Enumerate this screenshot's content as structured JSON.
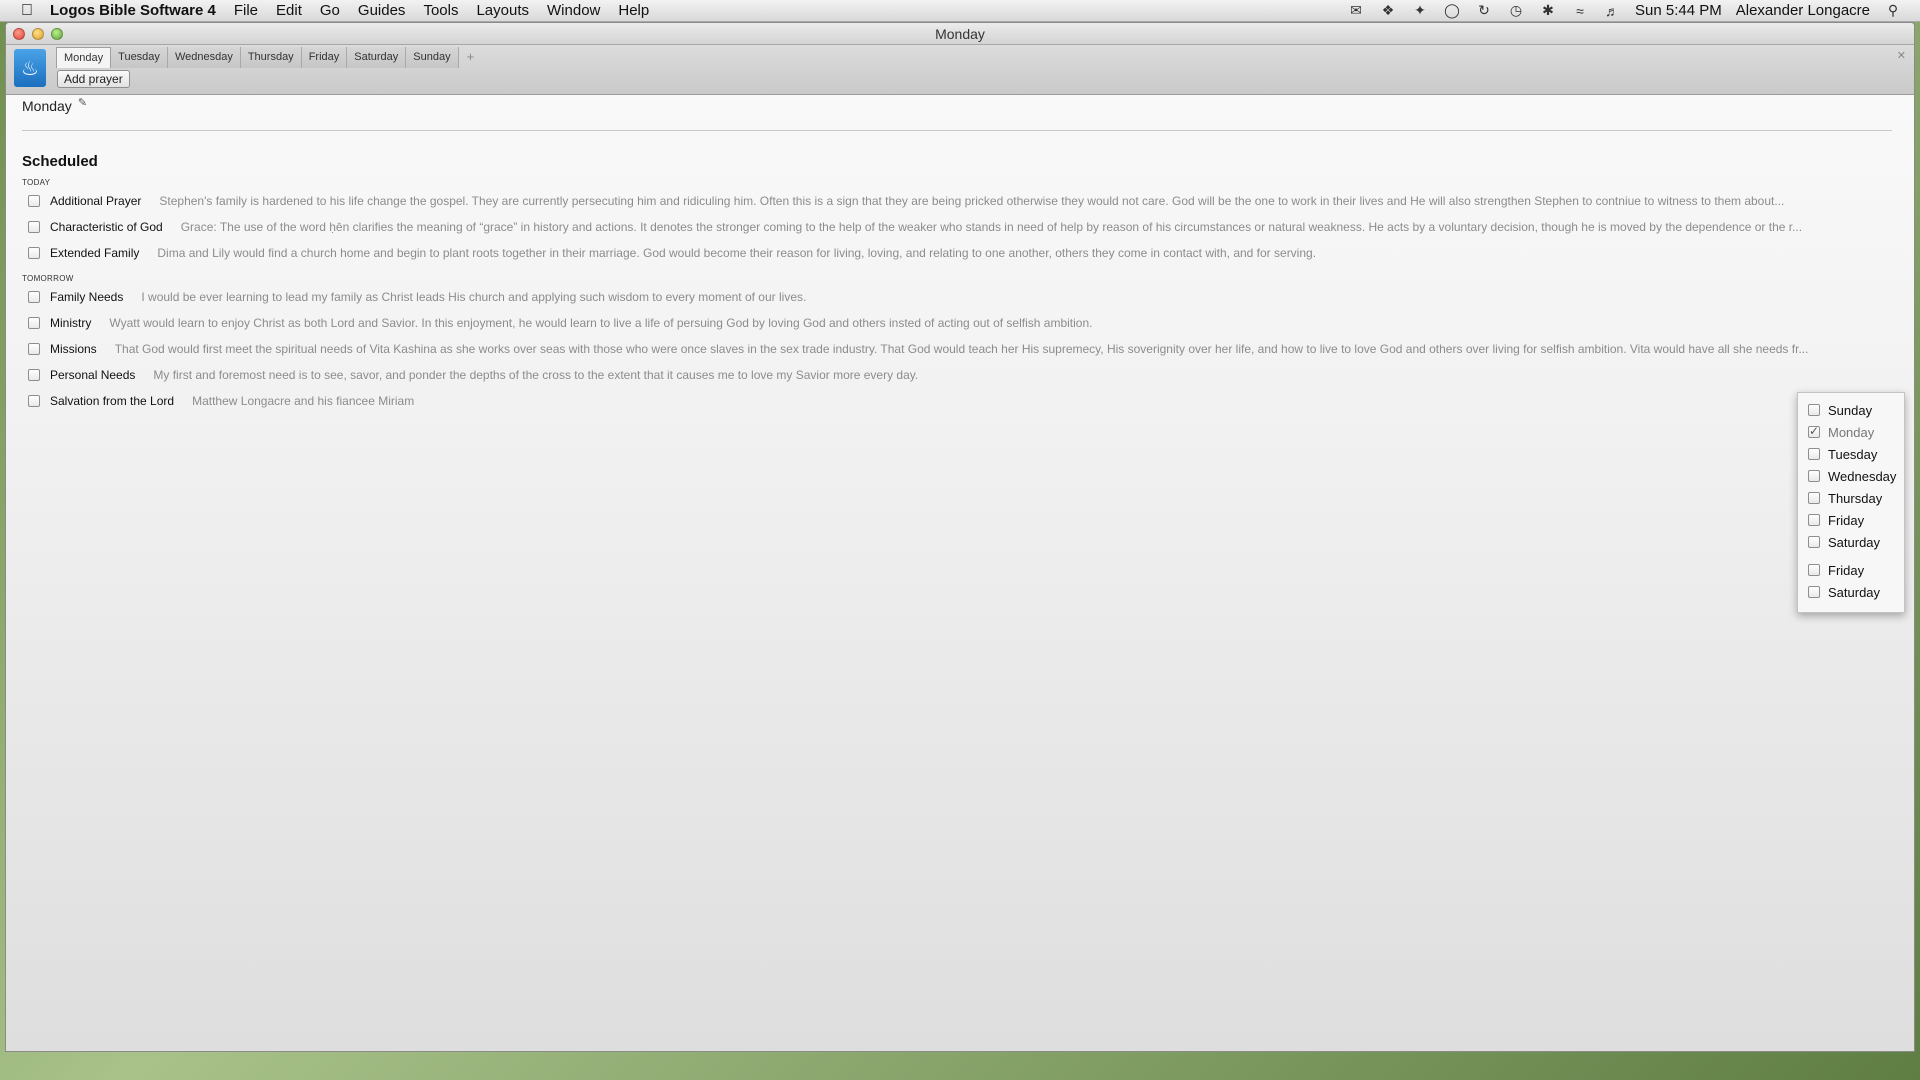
{
  "menubar": {
    "app_name": "Logos Bible Software 4",
    "items": [
      "File",
      "Edit",
      "Go",
      "Guides",
      "Tools",
      "Layouts",
      "Window",
      "Help"
    ],
    "clock": "Sun 5:44 PM",
    "user": "Alexander Longacre"
  },
  "window": {
    "title": "Monday"
  },
  "toolbar": {
    "tabs": [
      "Monday",
      "Tuesday",
      "Wednesday",
      "Thursday",
      "Friday",
      "Saturday",
      "Sunday"
    ],
    "add_tab": "+",
    "add_prayer_label": "Add prayer"
  },
  "content": {
    "heading": "Monday",
    "section_title": "Scheduled",
    "groups": [
      {
        "label": "TODAY",
        "items": [
          {
            "title": "Additional Prayer",
            "desc": "Stephen's family is hardened to his life change the gospel. They are currently persecuting him and ridiculing him. Often this is a sign that they are being pricked otherwise they would not care. God will be the one to work in their lives and He will also strengthen Stephen to contniue to witness to them about..."
          },
          {
            "title": "Characteristic of God",
            "desc": "Grace: The use of the word ḥēn clarifies the meaning of “grace” in history and actions. It denotes the stronger coming to the help of the weaker who stands in need of help by reason of his circumstances or natural weakness. He acts by a voluntary decision, though he is moved by the dependence or the r..."
          },
          {
            "title": "Extended Family",
            "desc": "Dima and Lily would find a church home and begin to plant roots together in their marriage. God would become their reason for living, loving, and relating to one another, others they come in contact with, and for serving."
          }
        ]
      },
      {
        "label": "TOMORROW",
        "items": [
          {
            "title": "Family Needs",
            "desc": "I would be ever learning to lead my family as Christ leads His church and applying such wisdom to every moment of our lives."
          },
          {
            "title": "Ministry",
            "desc": "Wyatt would learn to enjoy Christ as both Lord and Savior. In this enjoyment, he would learn to live a life of persuing God by loving God and others insted of acting out of selfish ambition."
          },
          {
            "title": "Missions",
            "desc": "That God would first meet the spiritual needs of Vita Kashina as she works over seas with those who were once slaves in the sex trade industry. That God would teach her His supremecy, His soverignity over her life, and how to live to love God and others over living for selfish ambition. Vita would have all she needs fr..."
          },
          {
            "title": "Personal Needs",
            "desc": "My first and foremost need is to see, savor, and ponder the depths of the cross to the extent that it causes me to love my Savior more every day."
          },
          {
            "title": "Salvation from the Lord",
            "desc": "Matthew Longacre and his fiancee Miriam"
          }
        ]
      }
    ]
  },
  "popup": {
    "days": [
      {
        "label": "Sunday",
        "checked": false
      },
      {
        "label": "Monday",
        "checked": true
      },
      {
        "label": "Tuesday",
        "checked": false
      },
      {
        "label": "Wednesday",
        "checked": false
      },
      {
        "label": "Thursday",
        "checked": false
      },
      {
        "label": "Friday",
        "checked": false
      },
      {
        "label": "Saturday",
        "checked": false
      }
    ],
    "extra_days": [
      "Friday",
      "Saturday"
    ]
  }
}
